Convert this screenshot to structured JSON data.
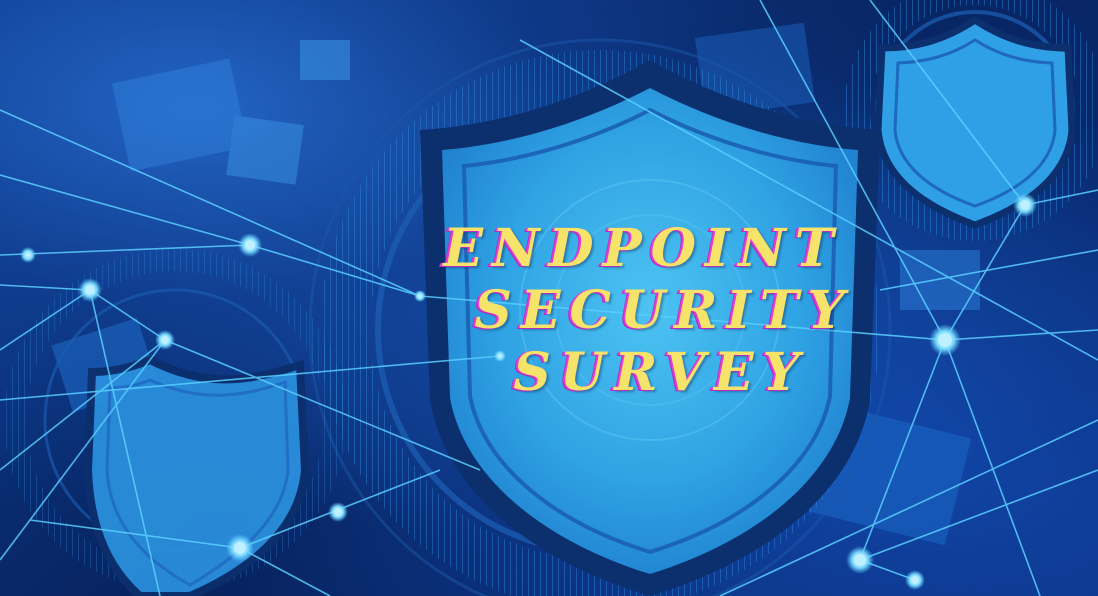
{
  "image": {
    "description_tags": [
      "shield-icon",
      "network-mesh",
      "gear-ring"
    ],
    "colors": {
      "background_dark": "#07235e",
      "background_mid": "#0b3a8c",
      "shield_fill": "#2fa3e3",
      "shield_outline": "#0b2f70",
      "network_line": "#5ad0ff",
      "title_fill": "#f5e36a",
      "title_shadow": "#e23fd0"
    }
  },
  "title": {
    "line1": "ENDPOINT",
    "line2": "SECURITY",
    "line3": "SURVEY"
  }
}
